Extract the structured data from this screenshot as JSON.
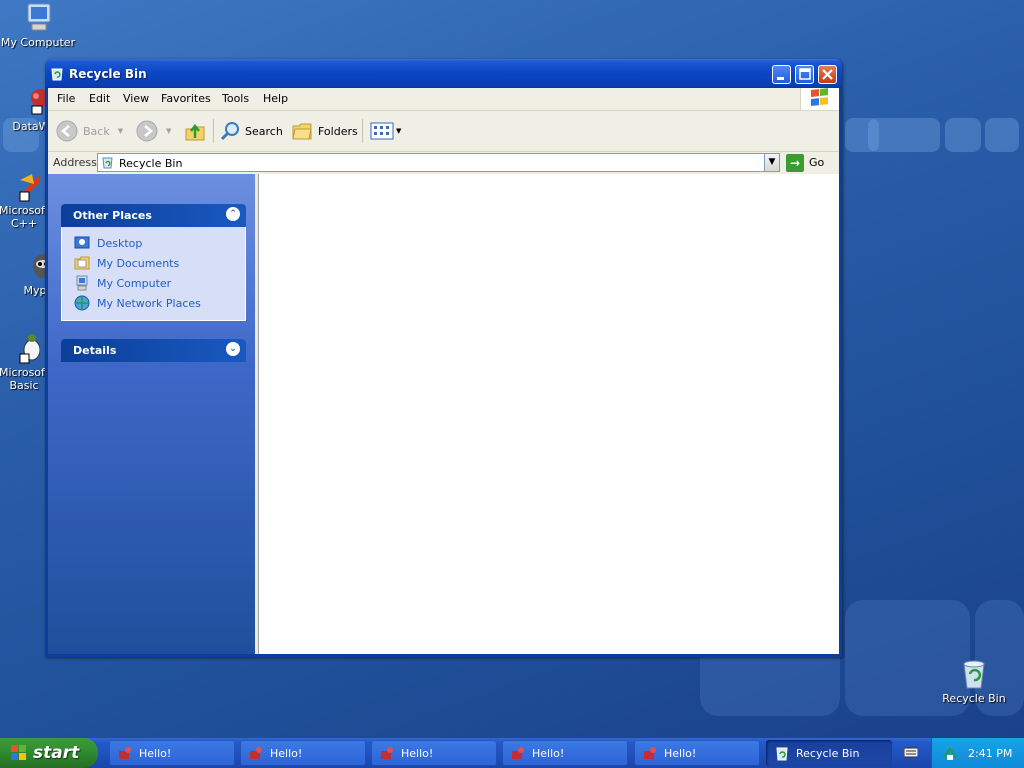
{
  "desktop": {
    "icons": [
      {
        "label": "My Computer"
      },
      {
        "label": "DataWa"
      },
      {
        "label": "Microsoft\nC++"
      },
      {
        "label": "Myp"
      },
      {
        "label": "Microsoft\nBasic"
      },
      {
        "label": "Recycle Bin"
      }
    ]
  },
  "window": {
    "title": "Recycle Bin",
    "menu": [
      "File",
      "Edit",
      "View",
      "Favorites",
      "Tools",
      "Help"
    ],
    "toolbar": {
      "back_label": "Back",
      "search_label": "Search",
      "folders_label": "Folders"
    },
    "address": {
      "label": "Address",
      "value": "Recycle Bin",
      "go_label": "Go"
    },
    "left_pane": {
      "other_places_title": "Other Places",
      "places": [
        "Desktop",
        "My Documents",
        "My Computer",
        "My Network Places"
      ],
      "details_title": "Details"
    }
  },
  "taskbar": {
    "start_label": "start",
    "tasks": [
      {
        "label": "Hello!"
      },
      {
        "label": "Hello!"
      },
      {
        "label": "Hello!"
      },
      {
        "label": "Hello!"
      },
      {
        "label": "Hello!"
      },
      {
        "label": "Recycle Bin",
        "active": true
      }
    ],
    "clock": "2:41 PM"
  },
  "colors": {
    "titlebar": "#0a46c4",
    "link": "#215dc6",
    "start_green": "#2f8a2f",
    "tray": "#0f8ad8"
  }
}
